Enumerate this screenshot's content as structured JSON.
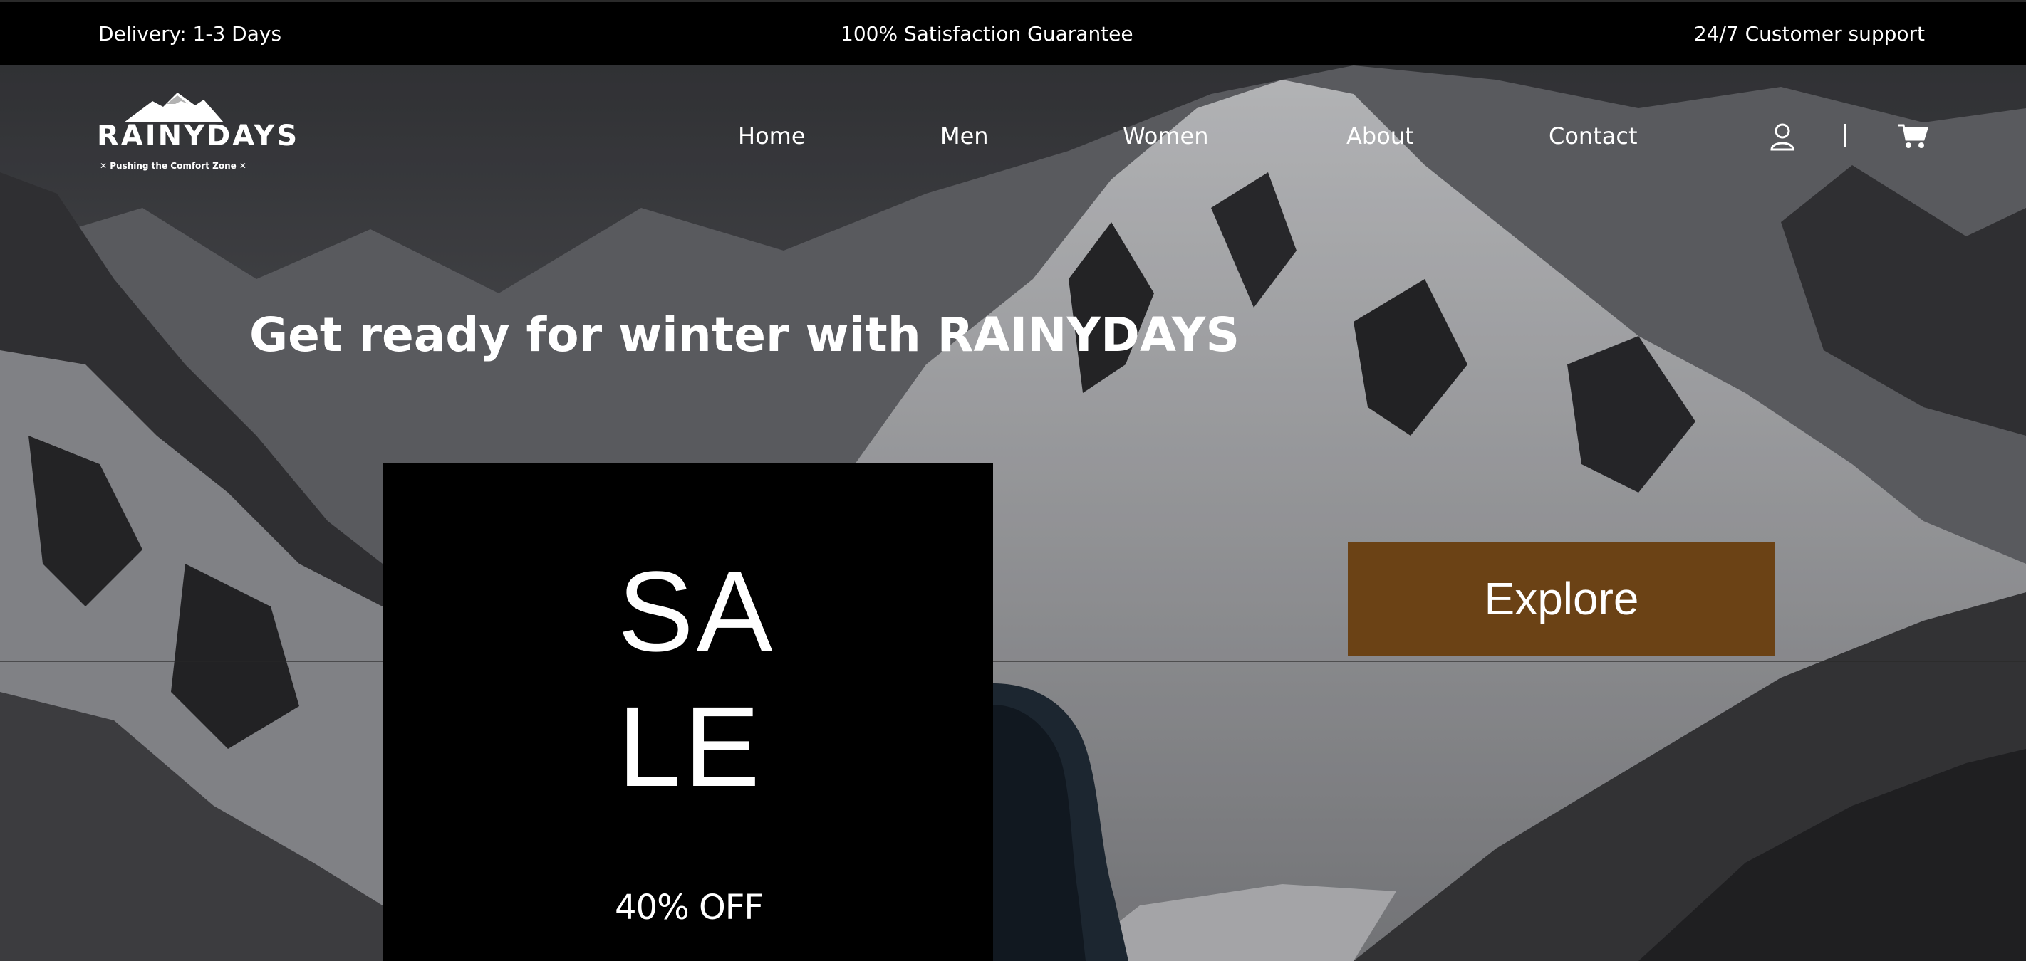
{
  "topbar": {
    "delivery": "Delivery: 1-3 Days",
    "guarantee": "100% Satisfaction Guarantee",
    "support": "24/7 Customer support"
  },
  "brand": {
    "name": "RAINYDAYS",
    "tagline": "✕ Pushing the Comfort Zone ✕"
  },
  "nav": {
    "items": [
      {
        "label": "Home"
      },
      {
        "label": "Men"
      },
      {
        "label": "Women"
      },
      {
        "label": "About"
      },
      {
        "label": "Contact"
      }
    ],
    "icons": [
      "user-icon",
      "cart-icon"
    ]
  },
  "hero": {
    "headline": "Get ready for winter with RAINYDAYS",
    "sale_line1": "SA",
    "sale_line2": "LE",
    "sale_discount": "40% OFF",
    "cta_label": "Explore"
  },
  "colors": {
    "topbar_bg": "#000000",
    "sale_box_bg": "#000000",
    "cta_bg": "#6b4215",
    "text": "#ffffff"
  }
}
